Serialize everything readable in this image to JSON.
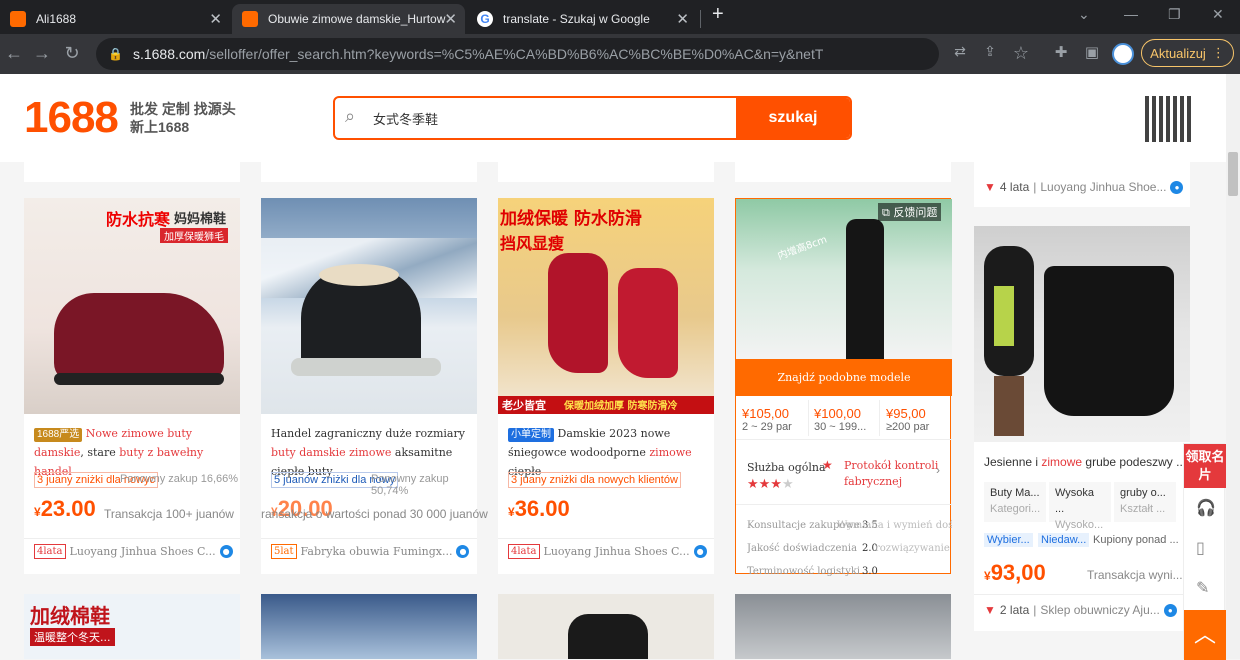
{
  "browser": {
    "tabs": [
      {
        "title": "Ali1688"
      },
      {
        "title": "Obuwie zimowe damskie_Hurtow"
      },
      {
        "title": "translate - Szukaj w Google"
      }
    ],
    "url_host": "s.1688.com",
    "url_path": "/selloffer/offer_search.htm?keywords=%C5%AE%CA%BD%B6%AC%BC%BE%D0%AC&n=y&netType=1%2C11%2C16&sp...",
    "update_label": "Aktualizuj",
    "icons": [
      "back-icon",
      "forward-icon",
      "reload-icon",
      "lock-icon",
      "translate-icon",
      "share-icon",
      "star-icon",
      "extensions-icon",
      "sidepanel-icon",
      "profile-icon",
      "menu-icon"
    ]
  },
  "header": {
    "logo": "1688",
    "slogan1": "批发 定制 找源头",
    "slogan2": "新上1688",
    "search_value": "女式冬季鞋",
    "search_button": "szukaj"
  },
  "top_right_card": {
    "years": "4 lata",
    "supplier": "Luoyang Jinhua Shoe..."
  },
  "cards": [
    {
      "overlay1": "防水抗寒",
      "overlay2": "妈妈棉鞋",
      "overlay3": "加厚保暖狮毛",
      "badge": "1688严选",
      "title_red": "Nowe zimowe buty damskie",
      "title_mid": ", stare ",
      "title_red2": "buty z bawełny handel",
      "promo": "3 juany zniżki dla nowyc",
      "promo_over": "Ponowny zakup 16,66%",
      "price_symbol": "¥",
      "price": "23.00",
      "trans": "Transakcja 100+ juanów",
      "years": "4lata",
      "supplier": "Luoyang Jinhua Shoes C..."
    },
    {
      "title_pre": "Handel zagraniczny duże rozmiary ",
      "title_red": "buty damskie zimowe",
      "title_post": " aksamitne ciepłe buty",
      "promo": "5 juanów zniżki dla nowy",
      "promo_over": "Ponowny zakup 50,74%",
      "price_symbol": "¥",
      "price": "20.00",
      "trans": "ransakcja o wartości ponad 30 000 juanów",
      "years": "5lat",
      "supplier": "Fabryka obuwia Fumingx..."
    },
    {
      "overlay1": "加绒保暖 防水防滑",
      "overlay2": "挡风显瘦",
      "overlay3": "老少皆宜",
      "overlay4": "保暖加绒加厚  防寒防滑冷",
      "badge": "小单定制",
      "title_pre": "Damskie 2023 nowe śniegowce wodoodporne ",
      "title_red": "zimowe",
      "title_post": " ciepłe",
      "promo": "3 juany zniżki dla nowych klientów",
      "price_symbol": "¥",
      "price": "36.00",
      "years": "4lata",
      "supplier": "Luoyang Jinhua Shoes C..."
    },
    {
      "feedback": "反馈问题",
      "overlay": "内增高8cm",
      "find_similar": "Znajdź podobne modele",
      "tiers": [
        {
          "price": "¥105,00",
          "qty": "2 ~ 29 par"
        },
        {
          "price": "¥100,00",
          "qty": "30 ~ 199..."
        },
        {
          "price": "¥95,00",
          "qty": "≥200 par"
        }
      ],
      "service_label": "Służba ogólna",
      "protocol": "Protokół kontroli fabrycznej",
      "stars": 3,
      "ratings": [
        {
          "label": "Konsultacje zakupowe",
          "extra": "Wymiana i wymień dośw",
          "value": "3.5"
        },
        {
          "label": "Jakość doświadczenia",
          "extra": "rozwiązywanie spord",
          "value": "2.0"
        },
        {
          "label": "Terminowość logistyki",
          "extra": "",
          "value": "3.0"
        }
      ]
    },
    {
      "title_pre": "Jesienne i ",
      "title_red": "zimowe",
      "title_post": " grube podeszwy ...",
      "attrs": [
        {
          "v": "Buty Ma...",
          "k": "Kategori..."
        },
        {
          "v": "Wysoka ...",
          "k": "Wysoko..."
        },
        {
          "v": "gruby o...",
          "k": "Kształt ..."
        }
      ],
      "tag1": "Wybier...",
      "tag2": "Niedaw...",
      "repurchase": "Kupiony ponad ...",
      "price_symbol": "¥",
      "price": "93,00",
      "trans": "Transakcja wyni...",
      "years": "2 lata",
      "supplier": "Sklep obuwniczy Aju..."
    }
  ],
  "bottom_overlay": {
    "text1": "加绒棉鞋",
    "text2": "温暖整个冬天..."
  },
  "float": {
    "label": "领取名片"
  }
}
